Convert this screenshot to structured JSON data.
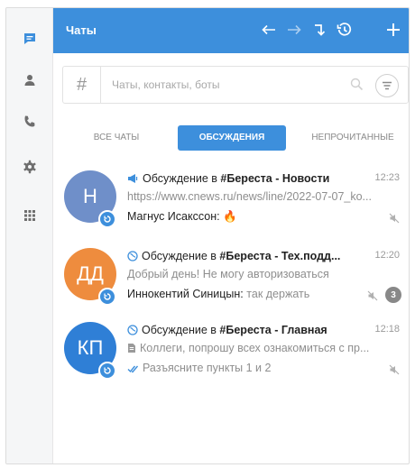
{
  "header": {
    "title": "Чаты"
  },
  "search": {
    "placeholder": "Чаты, контакты, боты",
    "hash": "#"
  },
  "tabs": [
    {
      "label": "ВСЕ ЧАТЫ",
      "active": false
    },
    {
      "label": "ОБСУЖДЕНИЯ",
      "active": true
    },
    {
      "label": "НЕПРОЧИТАННЫЕ",
      "active": false
    }
  ],
  "chats": [
    {
      "initials": "Н",
      "avatar_color": "#6f8fc9",
      "title_prefix": "Обсуждение в ",
      "title_channel": "#Береста - Новости",
      "time": "12:23",
      "preview": "https://www.cnews.ru/news/line/2022-07-07_ko...",
      "author": "Магнус Исакссон:",
      "message": "🔥",
      "unread": ""
    },
    {
      "initials": "ДД",
      "avatar_color": "#ee8c3e",
      "title_prefix": "Обсуждение в ",
      "title_channel": "#Береста - Тех.подд...",
      "time": "12:20",
      "preview": "Добрый день! Не могу авторизоваться",
      "author": "Иннокентий Синицын:",
      "message": "так держать",
      "unread": "3"
    },
    {
      "initials": "КП",
      "avatar_color": "#2f7fd6",
      "title_prefix": "Обсуждение в ",
      "title_channel": "#Береста - Главная",
      "time": "12:18",
      "preview": "Коллеги, попрошу всех ознакомиться с пр...",
      "author": "",
      "message": "Разъясните пункты 1 и 2",
      "unread": ""
    }
  ],
  "colors": {
    "accent": "#3d8fdc",
    "rail_bg": "#f5f6f7"
  },
  "icons": [
    "chat-icon",
    "contacts-icon",
    "phone-icon",
    "settings-icon",
    "apps-icon",
    "back-arrow-icon",
    "forward-arrow-icon",
    "redirect-icon",
    "history-icon",
    "plus-icon"
  ]
}
